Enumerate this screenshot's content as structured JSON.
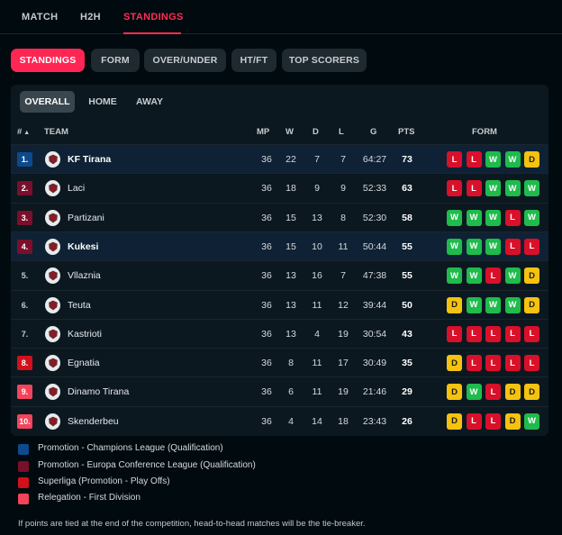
{
  "topnav": {
    "tabs": [
      "MATCH",
      "H2H",
      "STANDINGS"
    ],
    "active": 2
  },
  "pills": [
    "STANDINGS",
    "FORM",
    "OVER/UNDER",
    "HT/FT",
    "TOP SCORERS"
  ],
  "subtabs": [
    "OVERALL",
    "HOME",
    "AWAY"
  ],
  "headers": {
    "rank": "#",
    "sort_icon": "sort-up-icon",
    "team": "TEAM",
    "mp": "MP",
    "w": "W",
    "d": "D",
    "l": "L",
    "g": "G",
    "pts": "PTS",
    "form": "FORM"
  },
  "colors": {
    "champions": "#0c4a8c",
    "conference": "#7a0f2b",
    "playoffs": "#d1101c",
    "relegation": "#f2445a",
    "form_W": "#1fbb4c",
    "form_L": "#d9102a",
    "form_D": "#f5c20f",
    "accent": "#ff2654"
  },
  "rows": [
    {
      "rank": "1.",
      "zone": "champions",
      "team": "KF Tirana",
      "bold": true,
      "mp": "36",
      "w": "22",
      "d": "7",
      "l": "7",
      "g": "64:27",
      "pts": "73",
      "form": [
        "L",
        "L",
        "W",
        "W",
        "D"
      ]
    },
    {
      "rank": "2.",
      "zone": "conference",
      "team": "Laci",
      "bold": false,
      "mp": "36",
      "w": "18",
      "d": "9",
      "l": "9",
      "g": "52:33",
      "pts": "63",
      "form": [
        "L",
        "L",
        "W",
        "W",
        "W"
      ]
    },
    {
      "rank": "3.",
      "zone": "conference",
      "team": "Partizani",
      "bold": false,
      "mp": "36",
      "w": "15",
      "d": "13",
      "l": "8",
      "g": "52:30",
      "pts": "58",
      "form": [
        "W",
        "W",
        "W",
        "L",
        "W"
      ]
    },
    {
      "rank": "4.",
      "zone": "conference",
      "team": "Kukesi",
      "bold": true,
      "mp": "36",
      "w": "15",
      "d": "10",
      "l": "11",
      "g": "50:44",
      "pts": "55",
      "form": [
        "W",
        "W",
        "W",
        "L",
        "L"
      ]
    },
    {
      "rank": "5.",
      "zone": "none",
      "team": "Vllaznia",
      "bold": false,
      "mp": "36",
      "w": "13",
      "d": "16",
      "l": "7",
      "g": "47:38",
      "pts": "55",
      "form": [
        "W",
        "W",
        "L",
        "W",
        "D"
      ]
    },
    {
      "rank": "6.",
      "zone": "none",
      "team": "Teuta",
      "bold": false,
      "mp": "36",
      "w": "13",
      "d": "11",
      "l": "12",
      "g": "39:44",
      "pts": "50",
      "form": [
        "D",
        "W",
        "W",
        "W",
        "D"
      ]
    },
    {
      "rank": "7.",
      "zone": "none",
      "team": "Kastrioti",
      "bold": false,
      "mp": "36",
      "w": "13",
      "d": "4",
      "l": "19",
      "g": "30:54",
      "pts": "43",
      "form": [
        "L",
        "L",
        "L",
        "L",
        "L"
      ]
    },
    {
      "rank": "8.",
      "zone": "playoffs",
      "team": "Egnatia",
      "bold": false,
      "mp": "36",
      "w": "8",
      "d": "11",
      "l": "17",
      "g": "30:49",
      "pts": "35",
      "form": [
        "D",
        "L",
        "L",
        "L",
        "L"
      ]
    },
    {
      "rank": "9.",
      "zone": "relegation",
      "team": "Dinamo Tirana",
      "bold": false,
      "mp": "36",
      "w": "6",
      "d": "11",
      "l": "19",
      "g": "21:46",
      "pts": "29",
      "form": [
        "D",
        "W",
        "L",
        "D",
        "D"
      ]
    },
    {
      "rank": "10.",
      "zone": "relegation",
      "team": "Skenderbeu",
      "bold": false,
      "mp": "36",
      "w": "4",
      "d": "14",
      "l": "18",
      "g": "23:43",
      "pts": "26",
      "form": [
        "D",
        "L",
        "L",
        "D",
        "W"
      ]
    }
  ],
  "legend": [
    {
      "zone": "champions",
      "label": "Promotion - Champions League (Qualification)"
    },
    {
      "zone": "conference",
      "label": "Promotion - Europa Conference League (Qualification)"
    },
    {
      "zone": "playoffs",
      "label": "Superliga (Promotion - Play Offs)"
    },
    {
      "zone": "relegation",
      "label": "Relegation - First Division"
    }
  ],
  "note": "If points are tied at the end of the competition, head-to-head matches will be the tie-breaker."
}
